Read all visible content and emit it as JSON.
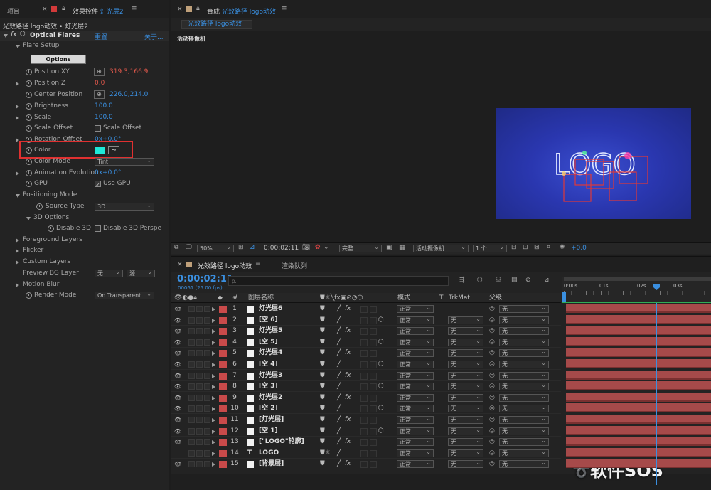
{
  "left_panel": {
    "tab_project": "项目",
    "tab_effects": "效果控件",
    "tab_effects_layer": "灯光层2",
    "breadcrumb": "光效路径 logo动效 • 灯光层2",
    "effect_name": "Optical Flares",
    "reset": "重置",
    "about": "关于...",
    "flare_setup": "Flare Setup",
    "options_button": "Options",
    "props": {
      "position_xy": "Position XY",
      "position_xy_value": "319.3,166.9",
      "position_z": "Position Z",
      "position_z_value": "0.0",
      "center_position": "Center Position",
      "center_position_value": "226.0,214.0",
      "brightness": "Brightness",
      "brightness_value": "100.0",
      "scale": "Scale",
      "scale_value": "100.0",
      "scale_offset": "Scale Offset",
      "scale_offset_check": "Scale Offset",
      "rotation_offset": "Rotation Offset",
      "rotation_offset_value": "0x+0.0°",
      "color": "Color",
      "color_mode": "Color Mode",
      "color_mode_value": "Tint",
      "animation_evolution": "Animation Evolution",
      "animation_evolution_value": "0x+0.0°",
      "gpu": "GPU",
      "use_gpu": "Use GPU",
      "positioning_mode": "Positioning Mode",
      "source_type": "Source Type",
      "source_type_value": "3D",
      "options_3d": "3D Options",
      "disable_3d": "Disable 3D",
      "disable_3d_check": "Disable 3D Perspe",
      "foreground_layers": "Foreground Layers",
      "flicker": "Flicker",
      "custom_layers": "Custom Layers",
      "preview_bg_layer": "Preview BG Layer",
      "preview_bg_value1": "无",
      "preview_bg_value2": "源",
      "motion_blur": "Motion Blur",
      "render_mode": "Render Mode",
      "render_mode_value": "On Transparent"
    }
  },
  "comp_panel": {
    "tab_prefix": "合成",
    "tab_name": "光效路径 logo动效",
    "subtab": "光效路径 logo动效",
    "camera_label": "活动摄像机",
    "logo_text": "LOGO",
    "zoom": "50%",
    "timecode": "0:00:02:11",
    "quality": "完整",
    "camera_select": "活动摄像机",
    "views": "1 个...",
    "exposure": "+0.0"
  },
  "timeline": {
    "tab_name": "光效路径 logo动效",
    "render_queue": "渲染队列",
    "timecode": "0:00:02:11",
    "frame_info": "00061 (25.00 fps)",
    "search_placeholder": "ρ.",
    "col_num": "#",
    "col_layer_name": "图层名称",
    "col_mode": "模式",
    "col_t": "T",
    "col_trkmat": "TrkMat",
    "col_parent": "父级",
    "ruler": [
      "0:00s",
      "01s",
      "02s",
      "03s"
    ],
    "layers": [
      {
        "num": "1",
        "name": "灯光层6",
        "kind": "solid",
        "fx": "fx",
        "cube": "",
        "mode": "正常",
        "trk": "",
        "parent": "无"
      },
      {
        "num": "2",
        "name": "[空 6]",
        "kind": "solid",
        "fx": "",
        "cube": "⬡",
        "mode": "正常",
        "trk": "无",
        "parent": "无"
      },
      {
        "num": "3",
        "name": "灯光层5",
        "kind": "solid",
        "fx": "fx",
        "cube": "",
        "mode": "正常",
        "trk": "无",
        "parent": "无"
      },
      {
        "num": "4",
        "name": "[空 5]",
        "kind": "solid",
        "fx": "",
        "cube": "⬡",
        "mode": "正常",
        "trk": "无",
        "parent": "无"
      },
      {
        "num": "5",
        "name": "灯光层4",
        "kind": "solid",
        "fx": "fx",
        "cube": "",
        "mode": "正常",
        "trk": "无",
        "parent": "无"
      },
      {
        "num": "6",
        "name": "[空 4]",
        "kind": "solid",
        "fx": "",
        "cube": "⬡",
        "mode": "正常",
        "trk": "无",
        "parent": "无"
      },
      {
        "num": "7",
        "name": "灯光层3",
        "kind": "solid",
        "fx": "fx",
        "cube": "",
        "mode": "正常",
        "trk": "无",
        "parent": "无"
      },
      {
        "num": "8",
        "name": "[空 3]",
        "kind": "solid",
        "fx": "",
        "cube": "⬡",
        "mode": "正常",
        "trk": "无",
        "parent": "无"
      },
      {
        "num": "9",
        "name": "灯光层2",
        "kind": "solid",
        "fx": "fx",
        "cube": "",
        "mode": "正常",
        "trk": "无",
        "parent": "无"
      },
      {
        "num": "10",
        "name": "[空 2]",
        "kind": "solid",
        "fx": "",
        "cube": "⬡",
        "mode": "正常",
        "trk": "无",
        "parent": "无"
      },
      {
        "num": "11",
        "name": "[灯光层]",
        "kind": "solid",
        "fx": "fx",
        "cube": "",
        "mode": "正常",
        "trk": "无",
        "parent": "无"
      },
      {
        "num": "12",
        "name": "[空 1]",
        "kind": "solid",
        "fx": "",
        "cube": "⬡",
        "mode": "正常",
        "trk": "无",
        "parent": "无"
      },
      {
        "num": "13",
        "name": "[\"LOGO\"轮廓]",
        "kind": "solid",
        "fx": "fx",
        "cube": "",
        "mode": "正常",
        "trk": "无",
        "parent": "无"
      },
      {
        "num": "14",
        "name": "LOGO",
        "kind": "text",
        "fx": "",
        "cube": "",
        "mode": "正常",
        "trk": "无",
        "parent": "无"
      },
      {
        "num": "15",
        "name": "[背景层]",
        "kind": "solid",
        "fx": "fx",
        "cube": "",
        "mode": "正常",
        "trk": "无",
        "parent": "无"
      }
    ]
  },
  "watermark": "软件SOS",
  "colors": {
    "accent_blue": "#3a8fe0",
    "value_red": "#e0584b",
    "label_red": "#c94a4a",
    "swatch_cyan": "#1ee8d8",
    "highlight_box": "#e03030",
    "comp_bg": "#2834a8"
  }
}
